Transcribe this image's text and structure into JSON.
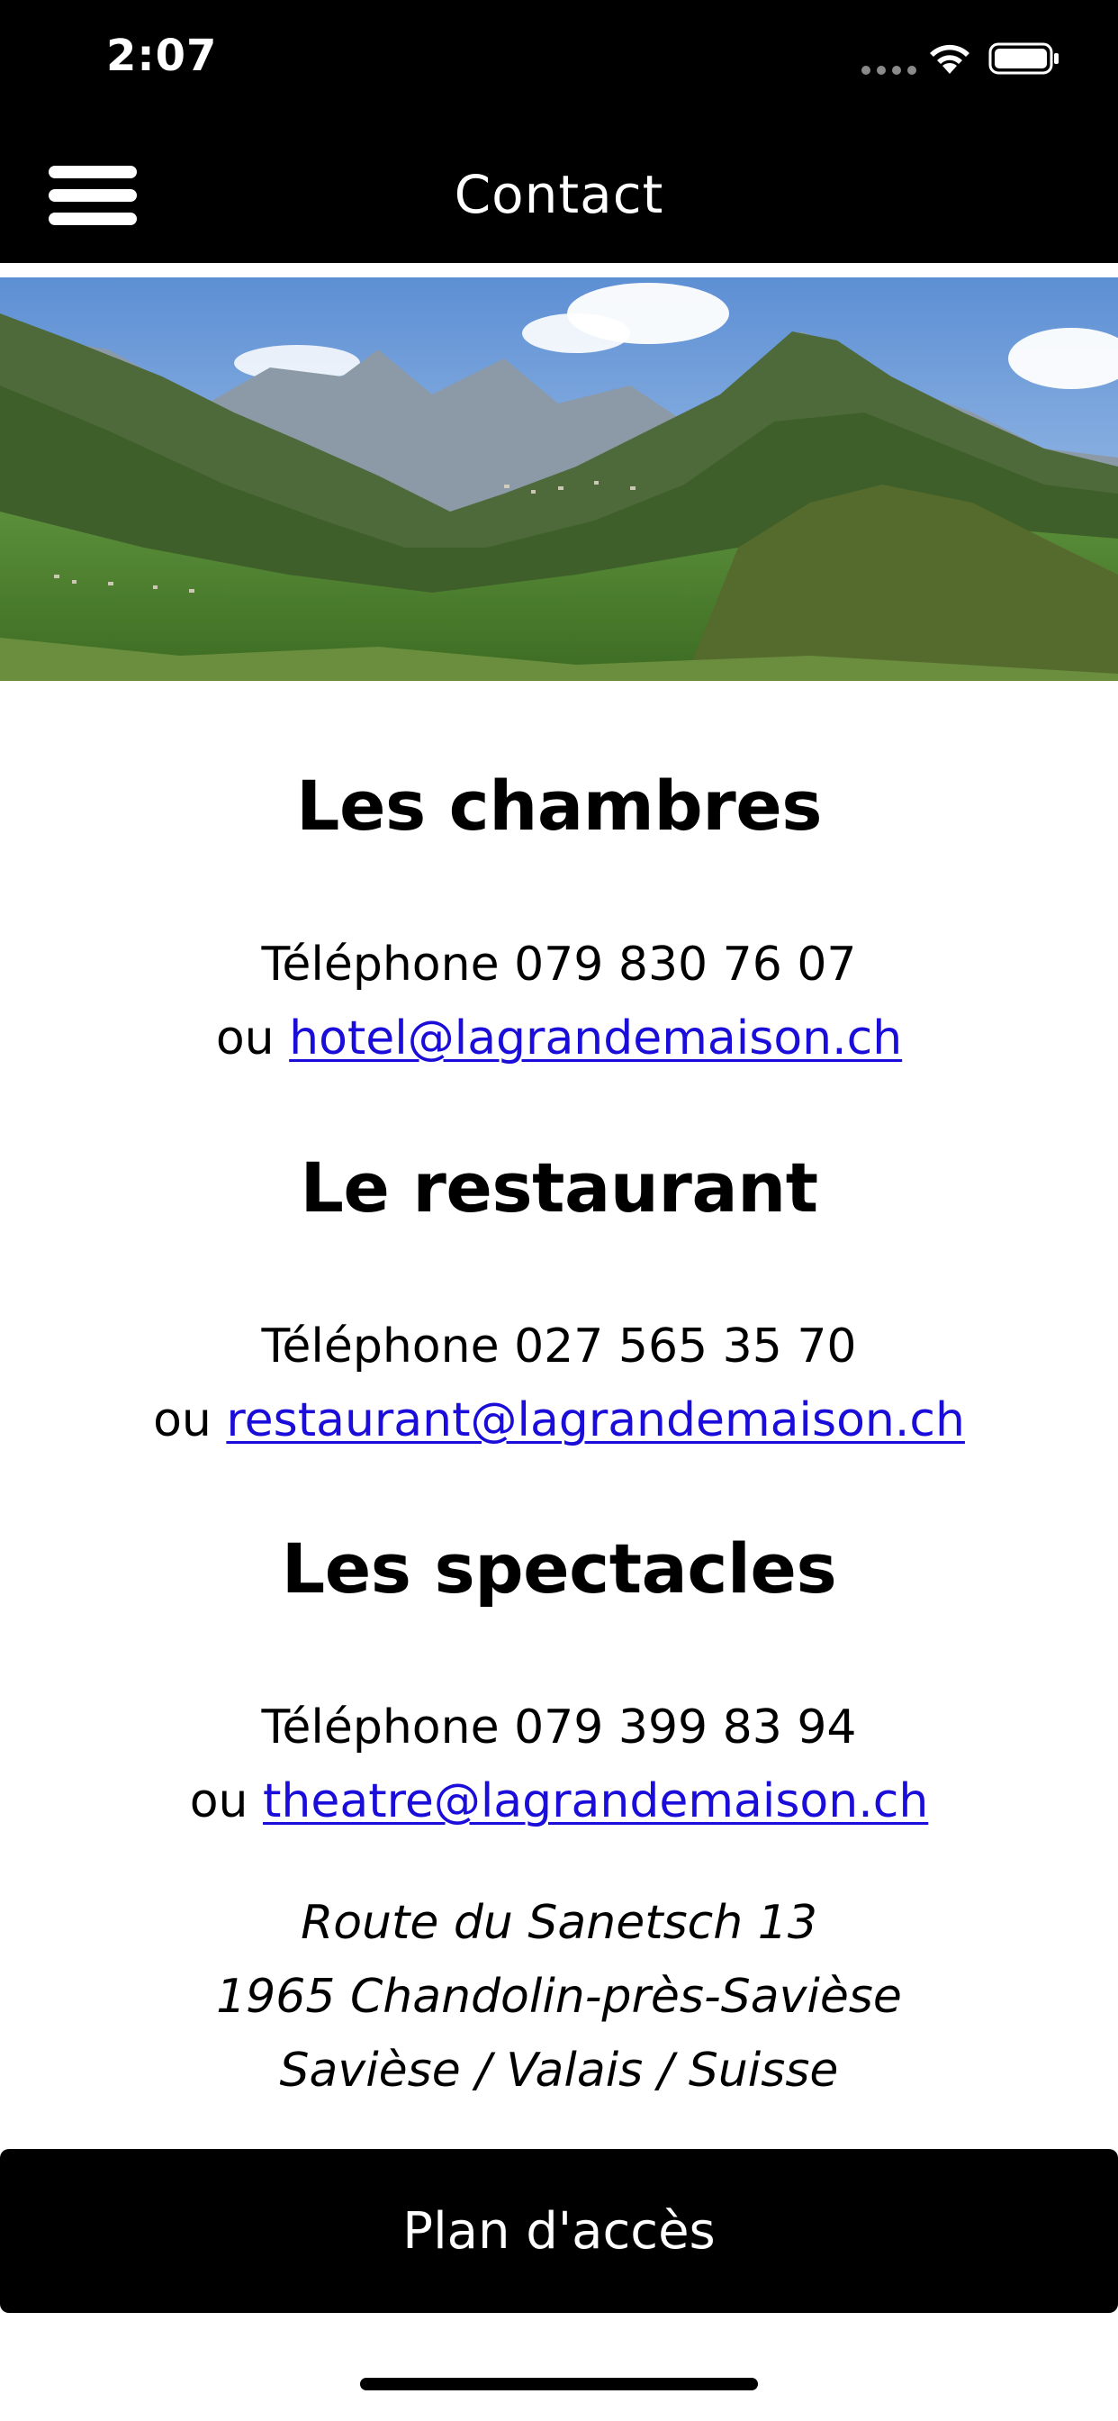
{
  "status_bar": {
    "time": "2:07",
    "icons": [
      "signal-dots-icon",
      "wifi-icon",
      "battery-icon"
    ]
  },
  "nav": {
    "title": "Contact",
    "menu_icon": "hamburger-menu-icon"
  },
  "hero": {
    "image": "alpine-valley-mountains-landscape"
  },
  "sections": [
    {
      "heading": "Les chambres",
      "phone_line": "Téléphone 079 830 76 07",
      "or_prefix": "ou ",
      "email": "hotel@lagrandemaison.ch"
    },
    {
      "heading": "Le restaurant",
      "phone_line": "Téléphone 027 565 35 70",
      "or_prefix": "ou ",
      "email": "restaurant@lagrandemaison.ch"
    },
    {
      "heading": "Les spectacles",
      "phone_line": "Téléphone 079 399 83 94",
      "or_prefix": "ou ",
      "email": "theatre@lagrandemaison.ch"
    }
  ],
  "address": {
    "line1": "Route du Sanetsch 13",
    "line2": "1965 Chandolin-près-Savièse",
    "line3": "Savièse / Valais / Suisse"
  },
  "footer": {
    "plan_button_label": "Plan d'accès"
  },
  "colors": {
    "bar_background": "#000000",
    "link": "#1a0dd9",
    "text": "#000000"
  }
}
